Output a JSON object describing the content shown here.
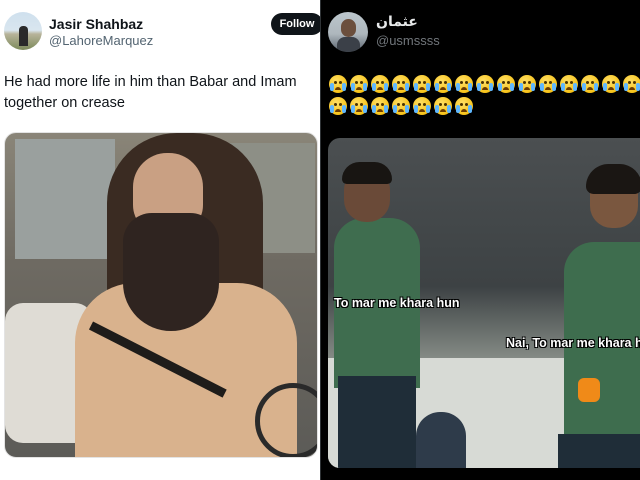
{
  "left_tweet": {
    "author_name": "Jasir Shahbaz",
    "author_handle": "@LahoreMarquez",
    "follow_label": "Follow",
    "text": "He had more life in him than Babar and Imam together on crease",
    "avatar_icon": "avatar-icon",
    "colors": {
      "follow_bg": "#0f1419",
      "text": "#0f1419",
      "handle": "#536471"
    }
  },
  "right_tweet": {
    "author_name": "عثمان",
    "author_handle": "@usmssss",
    "avatar_icon": "avatar-icon",
    "emoji_name": "loudly-crying-face",
    "emoji_rows": [
      16,
      7
    ],
    "captions": {
      "left_player": "To mar me khara hun",
      "right_player": "Nai, To mar me khara h"
    },
    "colors": {
      "background": "#000000",
      "name": "#e7e9ea",
      "handle": "#71767b"
    }
  }
}
